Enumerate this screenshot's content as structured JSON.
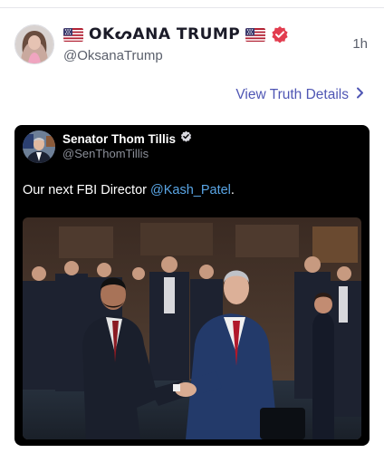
{
  "post": {
    "display_name": "OKᔕANA TRUMP",
    "handle": "@OksanaTrump",
    "time": "1h",
    "view_details_label": "View Truth Details"
  },
  "embed": {
    "name": "Senator Thom Tillis",
    "handle": "@SenThomTillis",
    "text_prefix": "Our next FBI Director ",
    "mention": "@Kash_Patel",
    "text_suffix": "."
  },
  "icons": {
    "flag": "us-flag-icon",
    "verified": "verified-badge-icon",
    "chevron": "chevron-right-icon"
  },
  "colors": {
    "accent": "#4f56b4",
    "verified_badge": "#e23d4f",
    "mention": "#5aa6e6"
  }
}
